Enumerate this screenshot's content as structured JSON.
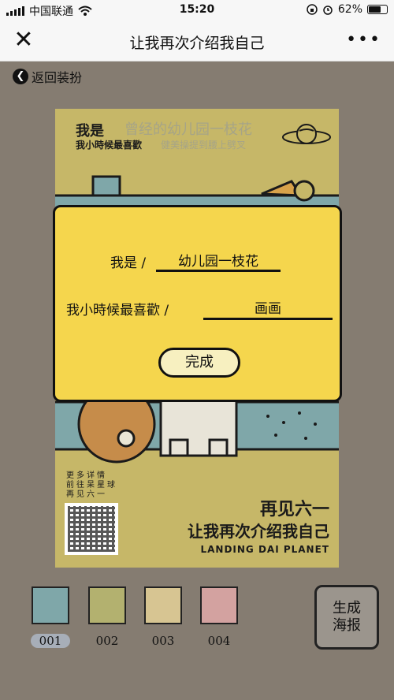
{
  "status_bar": {
    "carrier": "中国联通",
    "time": "15:20",
    "battery": "62%"
  },
  "nav": {
    "close": "✕",
    "title": "让我再次介绍我自己",
    "more": "•••"
  },
  "back": {
    "icon": "chevron-left-circle-icon",
    "label": "返回装扮"
  },
  "poster": {
    "line1_prefix": "我是",
    "line1_value": "曾经的幼儿园一枝花",
    "line2_prefix": "我小時候最喜歡",
    "line2_value": "健美操提到腰上劈叉",
    "info": [
      "更多详情",
      "前往呆星球",
      "再见六一"
    ],
    "headline": "再见六一",
    "slogan": "让我再次介绍我自己",
    "english": "LANDING DAI PLANET"
  },
  "modal": {
    "label_name": "我是 /",
    "value_name": "幼儿园一枝花",
    "label_fav": "我小時候最喜歡 /",
    "value_fav": "画画",
    "done": "完成"
  },
  "thumbnails": [
    {
      "label": "001",
      "selected": true,
      "color": "#7fa7a9"
    },
    {
      "label": "002",
      "selected": false,
      "color": "#b3b16f"
    },
    {
      "label": "003",
      "selected": false,
      "color": "#d7c592"
    },
    {
      "label": "004",
      "selected": false,
      "color": "#d3a2a0"
    }
  ],
  "generate": {
    "line1": "生成",
    "line2": "海报"
  }
}
